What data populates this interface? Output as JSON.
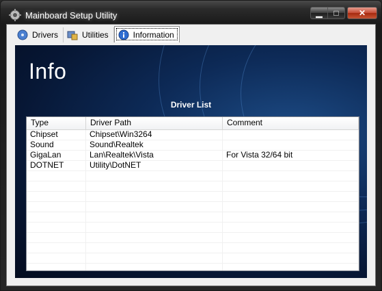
{
  "window": {
    "title": "Mainboard Setup Utility",
    "controls": {
      "minimize": "▁",
      "maximize": "□",
      "close": "✕"
    }
  },
  "tabs": [
    {
      "label": "Drivers",
      "icon": "drivers-cd-icon",
      "active": false
    },
    {
      "label": "Utilities",
      "icon": "utilities-tools-icon",
      "active": false
    },
    {
      "label": "Information",
      "icon": "information-icon",
      "active": true
    }
  ],
  "banner": {
    "heading": "Info",
    "list_caption": "Driver List"
  },
  "driver_list": {
    "columns": [
      "Type",
      "Driver Path",
      "Comment"
    ],
    "rows": [
      [
        "Chipset",
        "Chipset\\Win3264",
        ""
      ],
      [
        "Sound",
        "Sound\\Realtek",
        ""
      ],
      [
        "GigaLan",
        "Lan\\Realtek\\Vista",
        "For Vista 32/64 bit"
      ],
      [
        "DOTNET",
        "Utility\\DotNET",
        ""
      ],
      [
        "",
        "",
        ""
      ],
      [
        "",
        "",
        ""
      ],
      [
        "",
        "",
        ""
      ],
      [
        "",
        "",
        ""
      ],
      [
        "",
        "",
        ""
      ],
      [
        "",
        "",
        ""
      ],
      [
        "",
        "",
        ""
      ],
      [
        "",
        "",
        ""
      ],
      [
        "",
        "",
        ""
      ]
    ]
  },
  "colors": {
    "banner_dark": "#071735",
    "banner_light": "#1d4c86",
    "close_button": "#c44a33"
  }
}
